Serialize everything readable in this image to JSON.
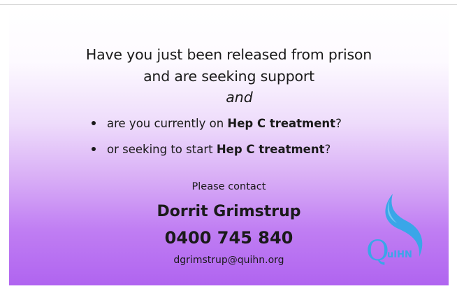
{
  "flyer": {
    "headline_line1": "Have you just been released from prison",
    "headline_line2": "and are seeking support",
    "conjunction": "and",
    "bullets": [
      {
        "prefix": "are you currently on ",
        "emphasis": "Hep C treatment",
        "suffix": "?"
      },
      {
        "prefix": "or seeking to start ",
        "emphasis": "Hep C treatment",
        "suffix": "?"
      }
    ],
    "contact_prompt": "Please contact",
    "contact_name": "Dorrit Grimstrup",
    "contact_phone": "0400 745 840",
    "contact_email": "dgrimstrup@quihn.org"
  },
  "logo": {
    "icon": "quihn-logo-icon",
    "text_initial": "Q",
    "text_rest": "uIHN",
    "color": "#3aa6e8"
  },
  "colors": {
    "gradient_top": "#ffffff",
    "gradient_bottom": "#b064f0",
    "text": "#1a1a1a"
  }
}
